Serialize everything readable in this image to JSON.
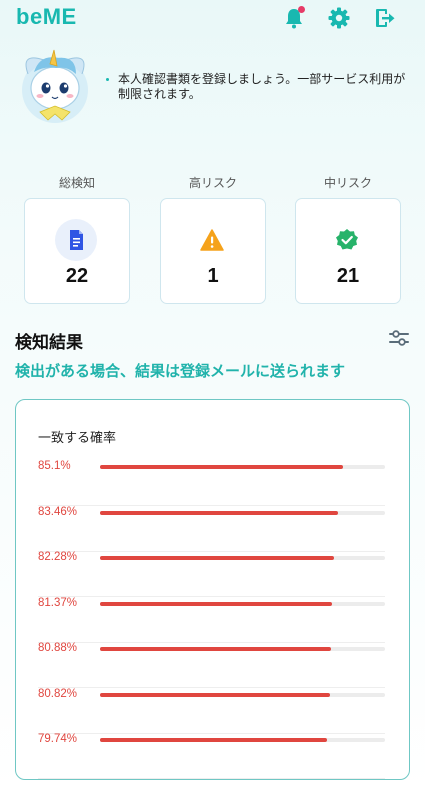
{
  "app": {
    "logo_prefix": "be",
    "logo_suffix": "ME"
  },
  "notice": {
    "text": "本人確認書類を登録しましょう。一部サービス利用が制限されます。"
  },
  "stats": [
    {
      "label": "総検知",
      "value": "22",
      "icon": "document-icon",
      "color": "#2f55e4"
    },
    {
      "label": "高リスク",
      "value": "1",
      "icon": "warning-icon",
      "color": "#f5a21b"
    },
    {
      "label": "中リスク",
      "value": "21",
      "icon": "check-badge-icon",
      "color": "#27b36a"
    }
  ],
  "section": {
    "title": "検知結果",
    "subtitle": "検出がある場合、結果は登録メールに送られます"
  },
  "results": {
    "title": "一致する確率",
    "rows": [
      {
        "label": "85.1%",
        "value": 85.1
      },
      {
        "label": "83.46%",
        "value": 83.46
      },
      {
        "label": "82.28%",
        "value": 82.28
      },
      {
        "label": "81.37%",
        "value": 81.37
      },
      {
        "label": "80.88%",
        "value": 80.88
      },
      {
        "label": "80.82%",
        "value": 80.82
      },
      {
        "label": "79.74%",
        "value": 79.74
      }
    ]
  },
  "colors": {
    "accent": "#19b8b0",
    "danger": "#e0463f",
    "notification": "#e63b67"
  }
}
